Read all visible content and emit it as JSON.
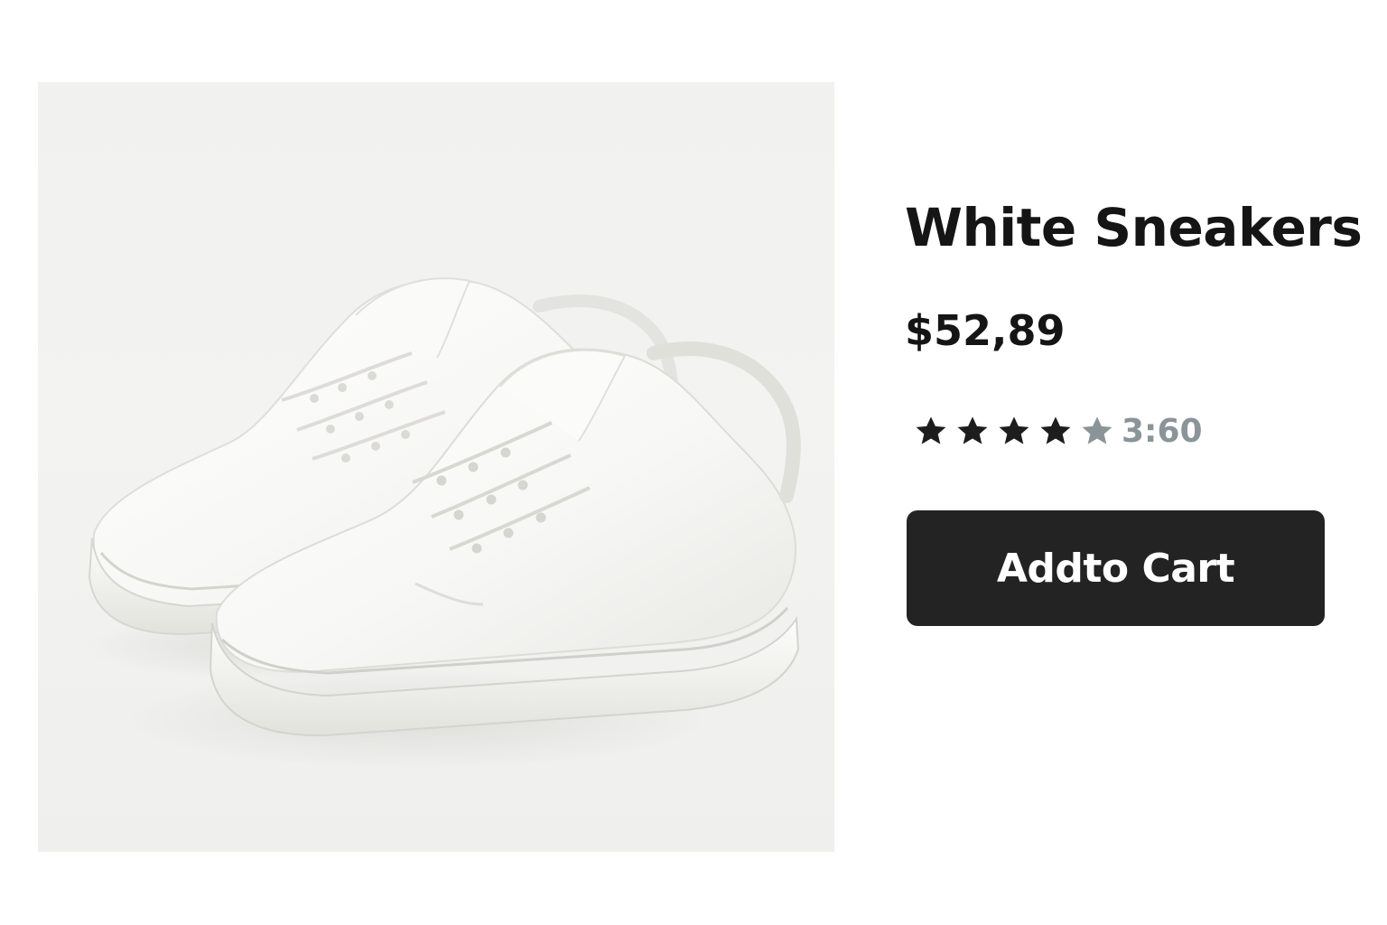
{
  "product": {
    "title": "White Sneakers",
    "price": "$52,89",
    "rating": {
      "value": 3.6,
      "label": "3:60",
      "max_stars": 5,
      "filled_stars": 4,
      "filled_color": "#1d1d1d",
      "empty_color": "#8b9499"
    },
    "image": {
      "icon": "white-sneakers-product-photo"
    },
    "actions": {
      "add_to_cart_label": "Addto Cart"
    }
  },
  "colors": {
    "background": "#ffffff",
    "image_background": "#f1f1ef",
    "text": "#151515",
    "button": "#232323",
    "button_text": "#ffffff"
  }
}
